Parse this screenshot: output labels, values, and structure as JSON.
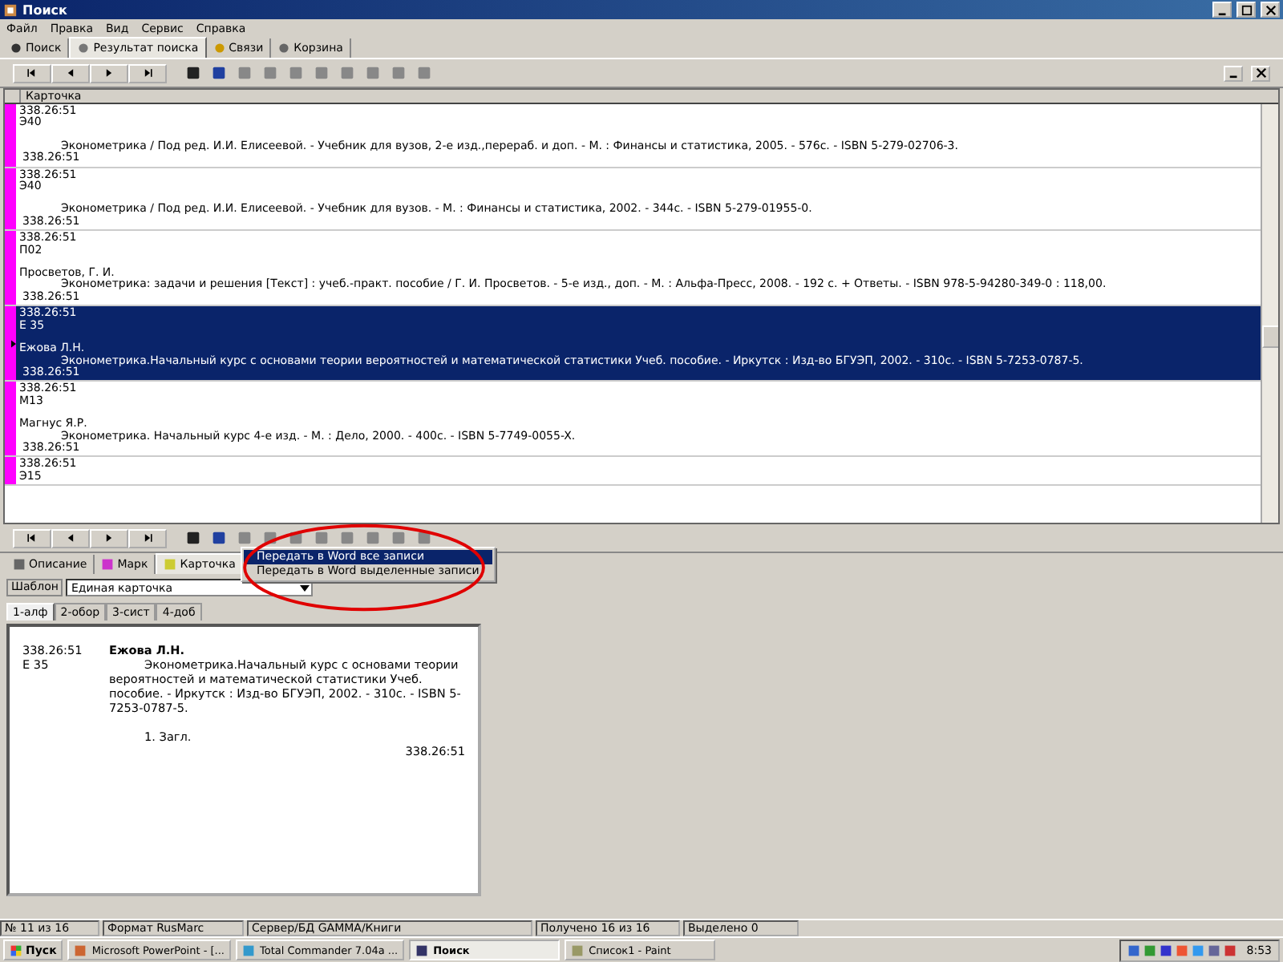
{
  "window": {
    "title": "Поиск"
  },
  "menu": [
    "Файл",
    "Правка",
    "Вид",
    "Сервис",
    "Справка"
  ],
  "tabs": [
    {
      "label": "Поиск",
      "selected": false
    },
    {
      "label": "Результат поиска",
      "selected": true
    },
    {
      "label": "Связи",
      "selected": false
    },
    {
      "label": "Корзина",
      "selected": false
    }
  ],
  "grid": {
    "column": "Карточка",
    "records": [
      {
        "code": "338.26:51",
        "mark": "Э40",
        "description": "Эконометрика / Под ред. И.И. Елисеевой. - Учебник для вузов, 2-е изд.,перераб. и доп. - М. : Финансы и статистика, 2005. - 576с. - ISBN 5-279-02706-3.",
        "shelf_code": "338.26:51",
        "selected": false
      },
      {
        "code": "338.26:51",
        "mark": "Э40",
        "description": "Эконометрика / Под ред. И.И. Елисеевой. - Учебник для вузов. - М. : Финансы и статистика, 2002. - 344с. - ISBN 5-279-01955-0.",
        "shelf_code": "338.26:51",
        "selected": false
      },
      {
        "code": "338.26:51",
        "mark": "П02",
        "author": "Просветов, Г. И.",
        "description": "Эконометрика: задачи и решения [Текст] : учеб.-практ. пособие / Г. И. Просветов. - 5-е изд., доп. - М. : Альфа-Пресс, 2008. - 192 с. + Ответы. - ISBN 978-5-94280-349-0 : 118,00.",
        "shelf_code": "338.26:51",
        "selected": false
      },
      {
        "code": "338.26:51",
        "mark": "Е 35",
        "author": "Ежова Л.Н.",
        "description": "Эконометрика.Начальный курс с основами теории вероятностей и математической статистики Учеб. пособие. - Иркутск : Изд-во БГУЭП, 2002. - 310с. - ISBN 5-7253-0787-5.",
        "shelf_code": "338.26:51",
        "selected": true
      },
      {
        "code": "338.26:51",
        "mark": "М13",
        "author": "Магнус Я.Р.",
        "description": "Эконометрика. Начальный курс 4-е изд. - М. : Дело, 2000. - 400с. - ISBN 5-7749-0055-X.",
        "shelf_code": "338.26:51",
        "selected": false
      },
      {
        "code": "338.26:51",
        "mark": "Э15",
        "selected": false
      }
    ]
  },
  "export_menu": [
    {
      "label": "Передать в Word все записи",
      "selected": true
    },
    {
      "label": "Передать в Word выделенные записи",
      "selected": false
    }
  ],
  "view_tabs": [
    {
      "label": "Описание",
      "selected": false
    },
    {
      "label": "Марк",
      "selected": false
    },
    {
      "label": "Карточка",
      "selected": true
    }
  ],
  "template": {
    "label": "Шаблон",
    "value": "Единая карточка"
  },
  "card_tabs": [
    {
      "label": "1-алф",
      "selected": true
    },
    {
      "label": "2-обор",
      "selected": false
    },
    {
      "label": "3-сист",
      "selected": false
    },
    {
      "label": "4-доб",
      "selected": false
    }
  ],
  "card": {
    "code": "338.26:51",
    "mark": "Е 35",
    "author": "Ежова Л.Н.",
    "description": "Эконометрика.Начальный курс с основами теории вероятностей и математической статистики Учеб. пособие. - Иркутск : Изд-во БГУЭП, 2002. - 310с. - ISBN 5-7253-0787-5.",
    "tracing": "1. Загл.",
    "shelf_code": "338.26:51"
  },
  "status_bar": [
    "№ 11 из 16",
    "Формат RusMarc",
    "Сервер/БД GAMMA/Книги",
    "Получено 16 из 16",
    "Выделено 0"
  ],
  "taskbar": {
    "start": "Пуск",
    "tasks": [
      {
        "label": "Microsoft PowerPoint - [...",
        "selected": false
      },
      {
        "label": "Total Commander 7.04a ...",
        "selected": false
      },
      {
        "label": "Поиск",
        "selected": true
      },
      {
        "label": "Список1 - Paint",
        "selected": false
      }
    ],
    "clock": "8:53"
  }
}
